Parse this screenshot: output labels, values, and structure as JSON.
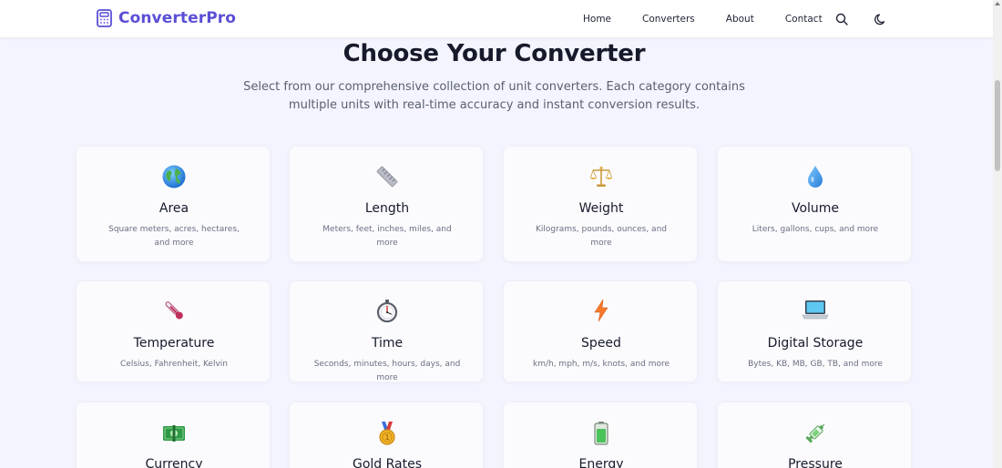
{
  "brand": {
    "name": "ConverterPro",
    "color": "#5b4fd6"
  },
  "nav": {
    "links": [
      "Home",
      "Converters",
      "About",
      "Contact"
    ],
    "icons": [
      "search-icon",
      "moon-icon"
    ]
  },
  "hero": {
    "title": "Choose Your Converter",
    "subtitle": "Select from our comprehensive collection of unit converters. Each category contains multiple units with real-time accuracy and instant conversion results."
  },
  "categories": [
    {
      "name": "Area",
      "desc": "Square meters, acres, hectares, and more",
      "icon": "globe-icon"
    },
    {
      "name": "Length",
      "desc": "Meters, feet, inches, miles, and more",
      "icon": "ruler-icon"
    },
    {
      "name": "Weight",
      "desc": "Kilograms, pounds, ounces, and more",
      "icon": "scales-icon"
    },
    {
      "name": "Volume",
      "desc": "Liters, gallons, cups, and more",
      "icon": "droplet-icon"
    },
    {
      "name": "Temperature",
      "desc": "Celsius, Fahrenheit, Kelvin",
      "icon": "thermometer-icon"
    },
    {
      "name": "Time",
      "desc": "Seconds, minutes, hours, days, and more",
      "icon": "stopwatch-icon"
    },
    {
      "name": "Speed",
      "desc": "km/h, mph, m/s, knots, and more",
      "icon": "lightning-icon"
    },
    {
      "name": "Digital Storage",
      "desc": "Bytes, KB, MB, GB, TB, and more",
      "icon": "laptop-icon"
    },
    {
      "name": "Currency",
      "desc": "",
      "icon": "money-icon"
    },
    {
      "name": "Gold Rates",
      "desc": "",
      "icon": "medal-icon"
    },
    {
      "name": "Energy",
      "desc": "",
      "icon": "battery-icon"
    },
    {
      "name": "Pressure",
      "desc": "",
      "icon": "syringe-icon"
    }
  ]
}
